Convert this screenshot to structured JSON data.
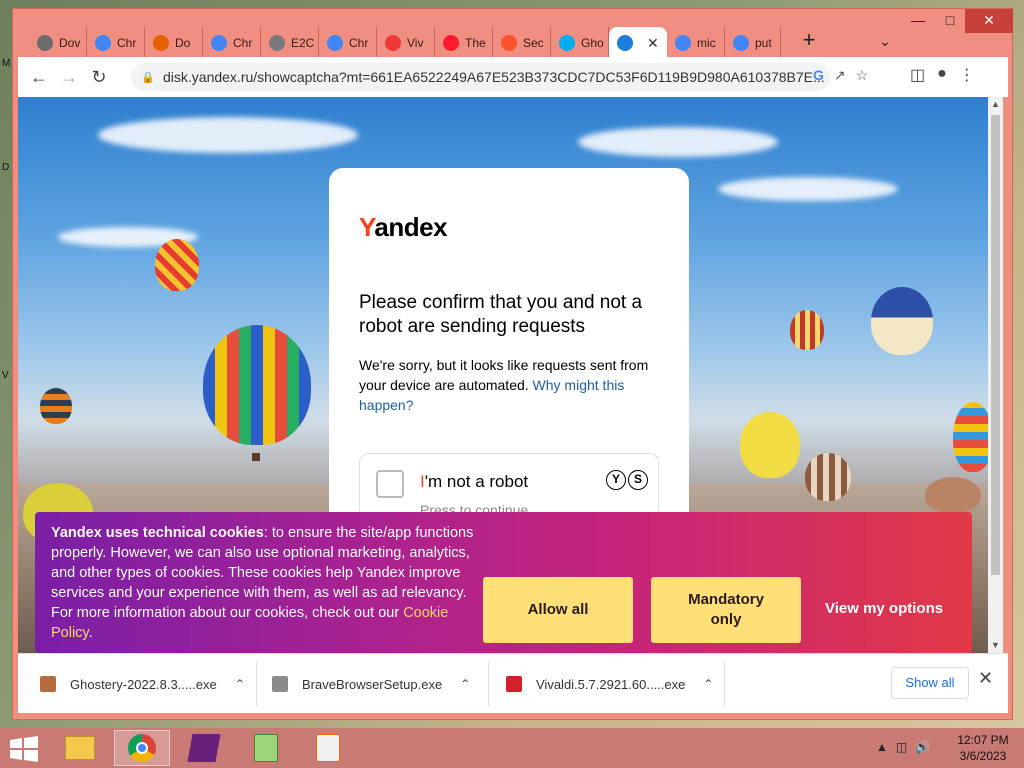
{
  "browser": {
    "tabs": [
      {
        "title": "Dov",
        "icon": "download-icon",
        "color": "#6b6b6b"
      },
      {
        "title": "Chr",
        "icon": "chrome-icon",
        "color": "#4285f4"
      },
      {
        "title": "Do",
        "icon": "firefox-icon",
        "color": "#e66000"
      },
      {
        "title": "Chr",
        "icon": "chrome-icon",
        "color": "#4285f4"
      },
      {
        "title": "E2C",
        "icon": "globe-icon",
        "color": "#7a7a7a"
      },
      {
        "title": "Chr",
        "icon": "chrome-icon",
        "color": "#4285f4"
      },
      {
        "title": "Viv",
        "icon": "vivaldi-icon",
        "color": "#ef3939"
      },
      {
        "title": "The",
        "icon": "opera-icon",
        "color": "#ff1b2d"
      },
      {
        "title": "Sec",
        "icon": "brave-icon",
        "color": "#fb542b"
      },
      {
        "title": "Gho",
        "icon": "ghostery-icon",
        "color": "#00aef0"
      },
      {
        "title": "",
        "icon": "yandex-disk-icon",
        "color": "#1a7fd8",
        "active": true
      },
      {
        "title": "mic",
        "icon": "google-icon",
        "color": "#4285f4"
      },
      {
        "title": "put",
        "icon": "google-icon",
        "color": "#4285f4"
      }
    ],
    "new_tab": "+",
    "url": "disk.yandex.ru/showcaptcha?mt=661EA6522249A67E523B373CDC7DC53F6D119B9D980A610378B7E..."
  },
  "captcha": {
    "logo": "andex",
    "logo_y": "Y",
    "heading": "Please confirm that you and not a robot are sending requests",
    "desc_text": "We're sorry, but it looks like requests sent from your device are automated.",
    "desc_link": "Why might this happen?",
    "robot_label_i": "I",
    "robot_label_rest": "'m not a robot",
    "press": "Press to continue",
    "sc_left": "Y",
    "sc_right": "S"
  },
  "cookie": {
    "bold": "Yandex uses technical cookies",
    "text": ": to ensure the site/app functions properly. However, we can also use optional marketing, analytics, and other types of cookies. These cookies help Yandex improve services and your experience with them, as well as ad relevancy. For more information about our cookies, check out our",
    "policy": "Cookie Policy",
    "policy_end": ".",
    "allow_all": "Allow all",
    "mandatory": "Mandatory only",
    "view_options": "View my options"
  },
  "downloads": {
    "items": [
      {
        "name": "Ghostery-2022.8.3.....exe",
        "color": "#b56a3b"
      },
      {
        "name": "BraveBrowserSetup.exe",
        "color": "#8a8a8a"
      },
      {
        "name": "Vivaldi.5.7.2921.60.....exe",
        "color": "#d3212b"
      }
    ],
    "show_all": "Show all"
  },
  "taskbar": {
    "time": "12:07 PM",
    "date": "3/6/2023"
  },
  "desktop_letters": [
    "M",
    "D",
    "V"
  ]
}
